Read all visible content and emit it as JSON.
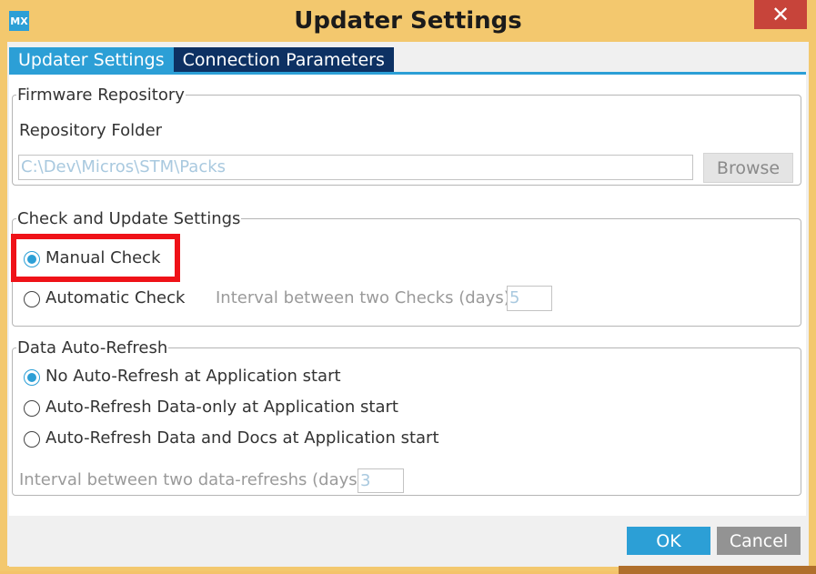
{
  "window": {
    "title": "Updater Settings",
    "app_icon_label": "MX",
    "close_glyph": "✕"
  },
  "tabs": [
    {
      "label": "Updater Settings",
      "active": true
    },
    {
      "label": "Connection Parameters",
      "active": false
    }
  ],
  "firmware": {
    "legend": "Firmware Repository",
    "folder_label": "Repository Folder",
    "folder_value": "C:\\Dev\\Micros\\STM\\Packs",
    "browse_label": "Browse"
  },
  "check": {
    "legend": "Check and Update Settings",
    "manual_label": "Manual Check",
    "manual_selected": true,
    "automatic_label": "Automatic Check",
    "automatic_selected": false,
    "interval_label": "Interval between two Checks (days)",
    "interval_value": "5"
  },
  "refresh": {
    "legend": "Data Auto-Refresh",
    "options": [
      {
        "label": "No Auto-Refresh at Application start",
        "selected": true
      },
      {
        "label": "Auto-Refresh Data-only at Application start",
        "selected": false
      },
      {
        "label": "Auto-Refresh Data and Docs at Application start",
        "selected": false
      }
    ],
    "interval_label": "Interval between two data-refreshs (days)",
    "interval_value": "3"
  },
  "footer": {
    "ok_label": "OK",
    "cancel_label": "Cancel"
  },
  "colors": {
    "accent": "#2c9fd6",
    "tab_inactive": "#0d3163",
    "highlight": "#ef1218",
    "close": "#c7443a",
    "title_bar": "#f3c86e"
  }
}
